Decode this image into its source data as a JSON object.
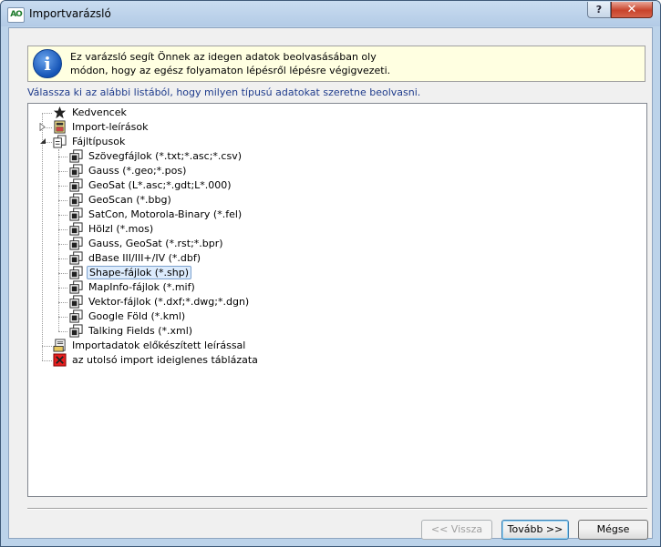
{
  "window": {
    "title": "Importvarázsló",
    "app_icon_text": "AO",
    "help_label": "?",
    "close_label": "✕"
  },
  "info": {
    "icon_text": "i",
    "line1": "Ez varázsló segít Önnek az idegen adatok beolvasásában oly",
    "line2": "módon, hogy az egész folyamaton lépésről lépésre végigvezeti."
  },
  "instruction": "Válassza ki az alábbi listából, hogy milyen típusú adatokat szeretne beolvasni.",
  "tree": {
    "favorites": "Kedvencek",
    "import_descriptions": "Import-leírások",
    "file_types": "Fájltípusok",
    "file_type_items": [
      "Szövegfájlok (*.txt;*.asc;*.csv)",
      "Gauss (*.geo;*.pos)",
      "GeoSat (L*.asc;*.gdt;L*.000)",
      "GeoScan (*.bbg)",
      "SatCon, Motorola-Binary (*.fel)",
      "Hölzl (*.mos)",
      "Gauss, GeoSat (*.rst;*.bpr)",
      "dBase III/III+/IV (*.dbf)",
      "Shape-fájlok (*.shp)",
      "MapInfo-fájlok (*.mif)",
      "Vektor-fájlok (*.dxf;*.dwg;*.dgn)",
      "Google Föld (*.kml)",
      "Talking Fields (*.xml)"
    ],
    "selected_item": "Shape-fájlok (*.shp)",
    "prepared_import": "Importadatok előkészített leírással",
    "last_import": "az utolsó import ideiglenes táblázata"
  },
  "buttons": {
    "back": "<< Vissza",
    "next": "Tovább >>",
    "cancel": "Mégse"
  },
  "colors": {
    "info_bg": "#ffffe1",
    "instruction_text": "#1e3b8c",
    "selection_bg": "#dcebfc"
  }
}
